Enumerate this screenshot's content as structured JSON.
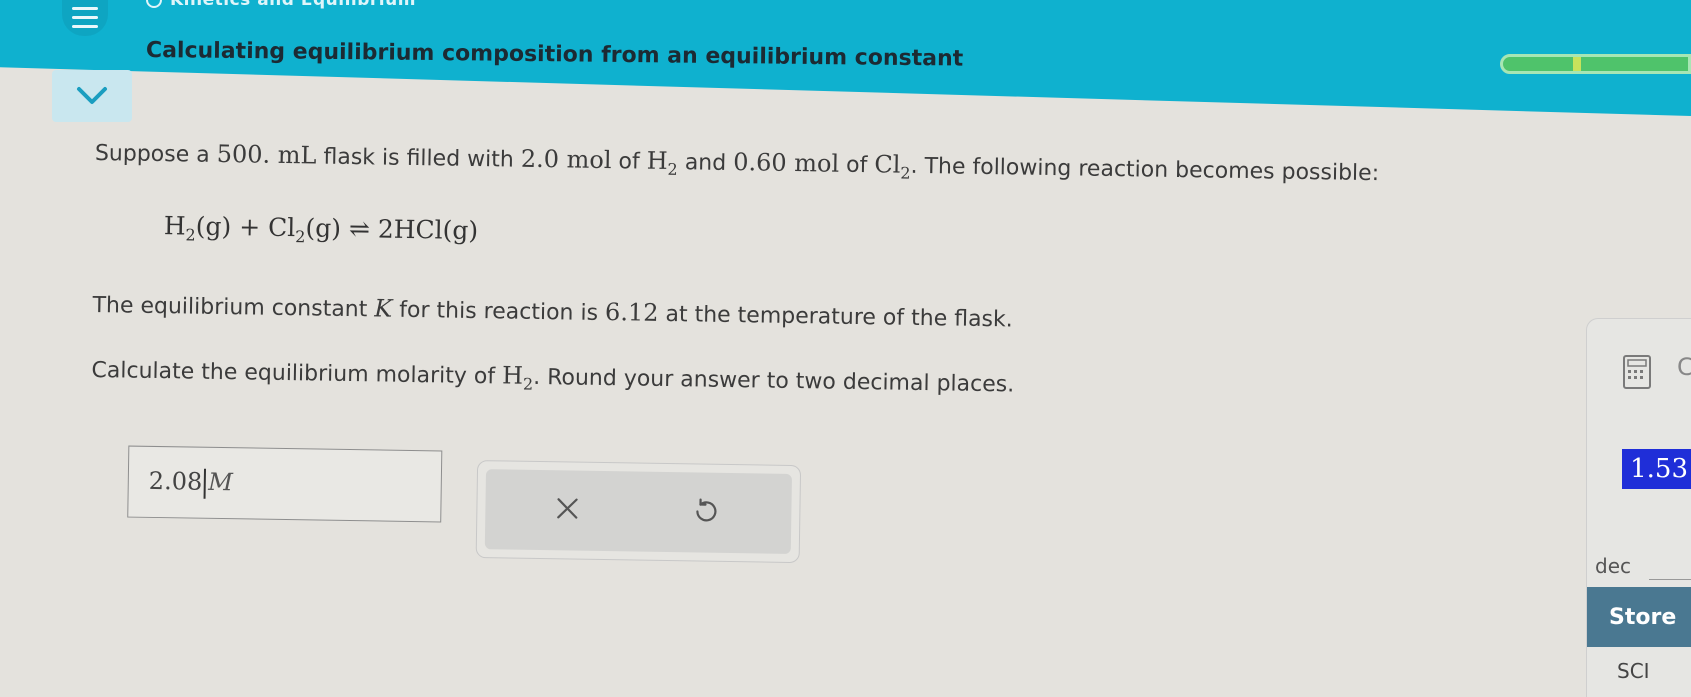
{
  "header": {
    "breadcrumb": "Kinetics and Equilibrium",
    "title": "Calculating equilibrium composition from an equilibrium constant",
    "progress_fraction": 0.55,
    "colors": {
      "header_bg": "#0fb1cf",
      "progress": "#4fc36b",
      "display": "#1f2ed8",
      "store": "#4a7891"
    }
  },
  "question": {
    "line1_a": "Suppose a",
    "line1_vol": "500. mL",
    "line1_b": "flask is filled with",
    "line1_mol1": "2.0 mol",
    "line1_c": "of",
    "line1_h": "H",
    "line1_h_sub": "2",
    "line1_d": "and",
    "line1_mol2": "0.60 mol",
    "line1_e": "of",
    "line1_cl": "Cl",
    "line1_cl_sub": "2",
    "line1_f": ". The following reaction becomes possible:",
    "eq_h": "H",
    "eq_h_sub": "2",
    "eq_g1": "(g)",
    "eq_plus": "+",
    "eq_cl": "Cl",
    "eq_cl_sub": "2",
    "eq_g2": "(g)",
    "eq_arrow": "⇌",
    "eq_prod": "2HCl(g)",
    "line2_a": "The equilibrium constant",
    "line2_k": "K",
    "line2_b": "for this reaction is",
    "line2_val": "6.12",
    "line2_c": "at the temperature of the flask.",
    "line3_a": "Calculate the equilibrium molarity of",
    "line3_h": "H",
    "line3_h_sub": "2",
    "line3_b": ". Round your answer to two decimal places."
  },
  "answer": {
    "value": "2.08",
    "unit": "M"
  },
  "calculator": {
    "display": "1.53",
    "c_label": "C",
    "dec_label": "dec",
    "store_label": "Store",
    "sci_label": "SCI"
  },
  "icons": {
    "menu": "hamburger-icon",
    "collapse": "chevron-down-icon",
    "clear": "close-icon",
    "undo": "undo-icon",
    "calculator": "calculator-icon"
  }
}
